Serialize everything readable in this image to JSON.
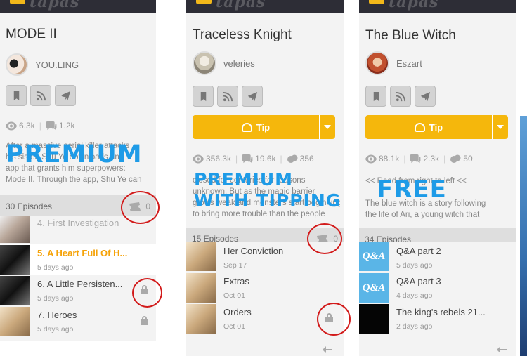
{
  "brand": {
    "logo_text": "tapas"
  },
  "colors": {
    "accent": "#f5b70c",
    "overlay_blue": "#1e9be7",
    "circle_red": "#d21a1a",
    "bar": "#2d2d36"
  },
  "panels": [
    {
      "title": "MODE II",
      "author": "YOU.LING",
      "actions": [
        "bookmark-icon",
        "rss-icon",
        "send-icon"
      ],
      "stats": {
        "views": "6.3k",
        "comments": "1.2k"
      },
      "description": [
        "After a massive serial killer attacks",
        "his sister, Shu Ye downloads an",
        "app that grants him superpowers:",
        "Mode II. Through the app, Shu Ye can"
      ],
      "overlay": [
        "PREMIUM"
      ],
      "episodes_count": "30 Episodes",
      "tickets": "0",
      "episodes": [
        {
          "title": "4. First Investigation",
          "date": "",
          "state": "dim",
          "locked": false
        },
        {
          "title": "5. A Heart Full Of H...",
          "date": "5 days ago",
          "state": "current",
          "locked": false
        },
        {
          "title": "6. A Little Persisten...",
          "date": "5 days ago",
          "state": "normal",
          "locked": true
        },
        {
          "title": "7. Heroes",
          "date": "5 days ago",
          "state": "normal",
          "locked": true
        }
      ]
    },
    {
      "title": "Traceless Knight",
      "author": "veleries",
      "actions": [
        "bookmark-icon",
        "rss-icon",
        "send-icon"
      ],
      "tip_label": "Tip",
      "stats": {
        "views": "356.3k",
        "comments": "19.6k",
        "likes": "356"
      },
      "description": [
        "closed for centuries for reasons",
        "unknown. But as the magic barrier",
        "grows weak and monsters start beginning",
        "to bring more trouble than the people"
      ],
      "overlay": [
        "PREMIUM",
        "WITH TIPPING"
      ],
      "episodes_count": "15 Episodes",
      "tickets": "0",
      "episodes": [
        {
          "title": "Her Conviction",
          "date": "Sep 17",
          "state": "normal",
          "locked": false
        },
        {
          "title": "Extras",
          "date": "Oct 01",
          "state": "normal",
          "locked": false
        },
        {
          "title": "Orders",
          "date": "Oct 01",
          "state": "normal",
          "locked": true
        }
      ]
    },
    {
      "title": "The Blue Witch",
      "author": "Eszart",
      "actions": [
        "bookmark-icon",
        "rss-icon",
        "send-icon"
      ],
      "tip_label": "Tip",
      "stats": {
        "views": "88.1k",
        "comments": "2.3k",
        "likes": "50"
      },
      "description": [
        "<< Read from right to left <<",
        "",
        "The blue witch is a story following",
        "the life of Ari, a young witch that"
      ],
      "overlay": [
        "FREE"
      ],
      "episodes_count": "34 Episodes",
      "episodes": [
        {
          "title": "Q&A part 2",
          "date": "5 days ago",
          "state": "normal",
          "locked": false,
          "thumb": "Q&A"
        },
        {
          "title": "Q&A part 3",
          "date": "4 days ago",
          "state": "normal",
          "locked": false,
          "thumb": "Q&A"
        },
        {
          "title": "The king's rebels 21...",
          "date": "2 days ago",
          "state": "normal",
          "locked": false,
          "thumb": ""
        }
      ]
    }
  ]
}
